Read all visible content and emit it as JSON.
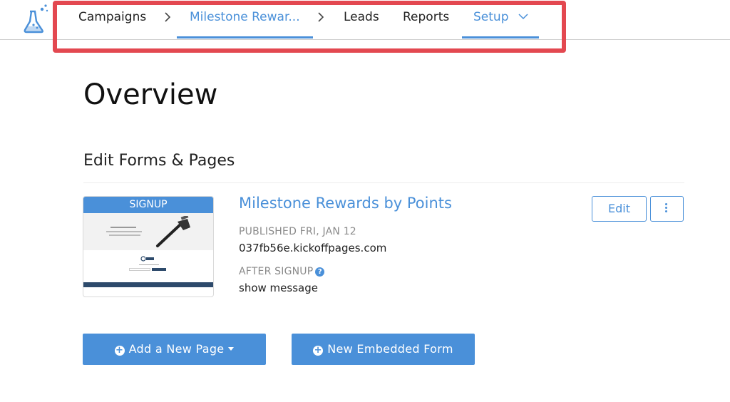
{
  "nav": {
    "campaigns": "Campaigns",
    "campaign_name": "Milestone Rewar...",
    "leads": "Leads",
    "reports": "Reports",
    "setup": "Setup"
  },
  "main": {
    "title": "Overview",
    "section_title": "Edit Forms & Pages"
  },
  "page_card": {
    "thumbnail_label": "SIGNUP",
    "title": "Milestone Rewards by Points",
    "published_label": "PUBLISHED FRI, JAN 12",
    "url": "037fb56e.kickoffpages.com",
    "after_signup_label": "AFTER SIGNUP",
    "help_glyph": "?",
    "after_signup_value": "show message",
    "edit_button": "Edit"
  },
  "actions": {
    "add_page": "Add a New Page",
    "new_form": "New Embedded Form"
  },
  "colors": {
    "accent": "#4a90d9",
    "highlight": "#e34850"
  },
  "icons": {
    "logo": "flask-icon",
    "separator": "chevron-right-icon",
    "dropdown": "chevron-down-icon",
    "more": "vertical-ellipsis-icon",
    "add": "plus-circle-icon"
  }
}
